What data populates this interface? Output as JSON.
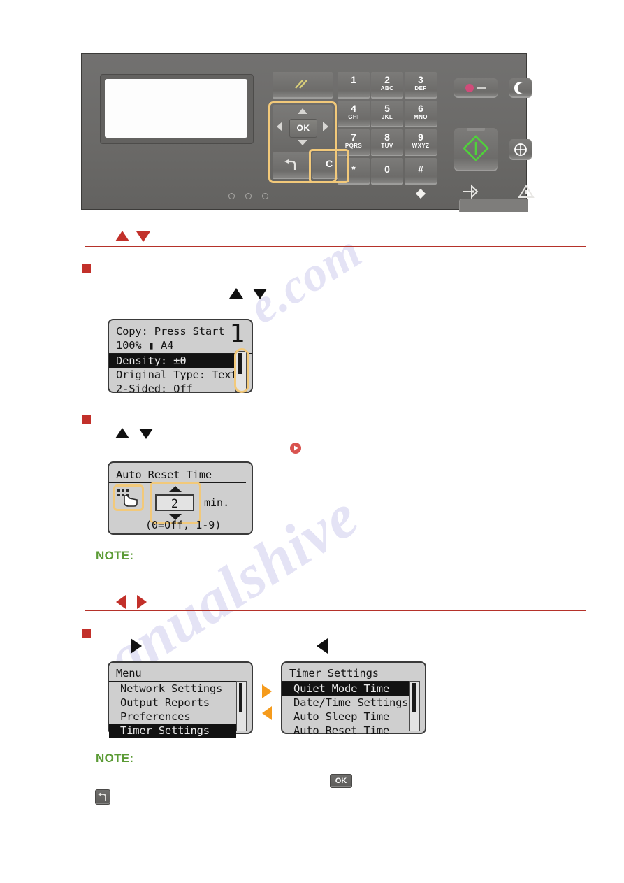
{
  "watermark": {
    "line1": "e.com",
    "line2": "anualshive"
  },
  "control_panel": {
    "name": "printer-control-panel",
    "display_blank": true,
    "keypad": [
      {
        "num": "1",
        "sub": ""
      },
      {
        "num": "2",
        "sub": "ABC"
      },
      {
        "num": "3",
        "sub": "DEF"
      },
      {
        "num": "4",
        "sub": "GHI"
      },
      {
        "num": "5",
        "sub": "JKL"
      },
      {
        "num": "6",
        "sub": "MNO"
      },
      {
        "num": "7",
        "sub": "PQRS"
      },
      {
        "num": "8",
        "sub": "TUV"
      },
      {
        "num": "9",
        "sub": "WXYZ"
      },
      {
        "num": "*",
        "sub": ""
      },
      {
        "num": "0",
        "sub": ""
      },
      {
        "num": "#",
        "sub": ""
      }
    ],
    "ok_label": "OK",
    "keys": {
      "reset": "reset-key",
      "back": "back-key",
      "clear": "C",
      "stop": "stop-key",
      "energy_saver": "energy-saver-key",
      "start": "start-key",
      "status_monitor": "status-monitor-key",
      "paper_feed_indicator": "paper-feed-indicator",
      "error_indicator": "error-indicator",
      "processing_indicator": "processing-data-indicator"
    },
    "highlight_color": "#f2c97a"
  },
  "sections": [
    {
      "id": "updown",
      "heading_icons": [
        "up-triangle",
        "down-triangle"
      ],
      "heading_color": "#c2302a"
    },
    {
      "id": "leftright",
      "heading_icons": [
        "left-triangle",
        "right-triangle"
      ],
      "heading_color": "#c2302a"
    }
  ],
  "screens": {
    "copy": {
      "title": "copy-basic-features-screen",
      "lines": [
        "Copy: Press Start",
        "100%  \u00031   A4",
        "Density: ±0",
        "Original Type: Text",
        "2-Sided: Off"
      ],
      "copies_count": "1",
      "zoom": "100%",
      "paper_size": "A4",
      "selected_line": "Density: ±0",
      "unselected_lines": [
        "Original Type: Text",
        "2-Sided: Off"
      ],
      "scrollbar": "visible"
    },
    "auto_reset": {
      "title": "Auto Reset Time",
      "value": "2",
      "unit": "min.",
      "range_hint": "(0=Off, 1-9)",
      "icon": "finger-entry-icon"
    },
    "menu": {
      "title": "Menu",
      "items": [
        {
          "label": "Network Settings",
          "selected": false
        },
        {
          "label": "Output Reports",
          "selected": false
        },
        {
          "label": "Preferences",
          "selected": false
        },
        {
          "label": "Timer Settings",
          "selected": true
        }
      ]
    },
    "timer_settings": {
      "title": "Timer Settings",
      "items": [
        {
          "label": "Quiet Mode Time",
          "selected": true
        },
        {
          "label": "Date/Time Settings",
          "selected": false
        },
        {
          "label": "Auto Sleep Time",
          "selected": false
        },
        {
          "label": "Auto Reset Time",
          "selected": false
        }
      ]
    }
  },
  "notes": {
    "note1_label": "NOTE:",
    "note2_label": "NOTE:",
    "color": "#5b9b35"
  },
  "inline_keys": {
    "ok": "OK",
    "back": "back-arrow-glyph"
  },
  "markers": {
    "play_badge": "play-circle-icon",
    "orange_right": "orange-right-triangle",
    "orange_left": "orange-left-triangle",
    "black_right": "black-right-triangle",
    "black_left": "black-left-triangle"
  }
}
